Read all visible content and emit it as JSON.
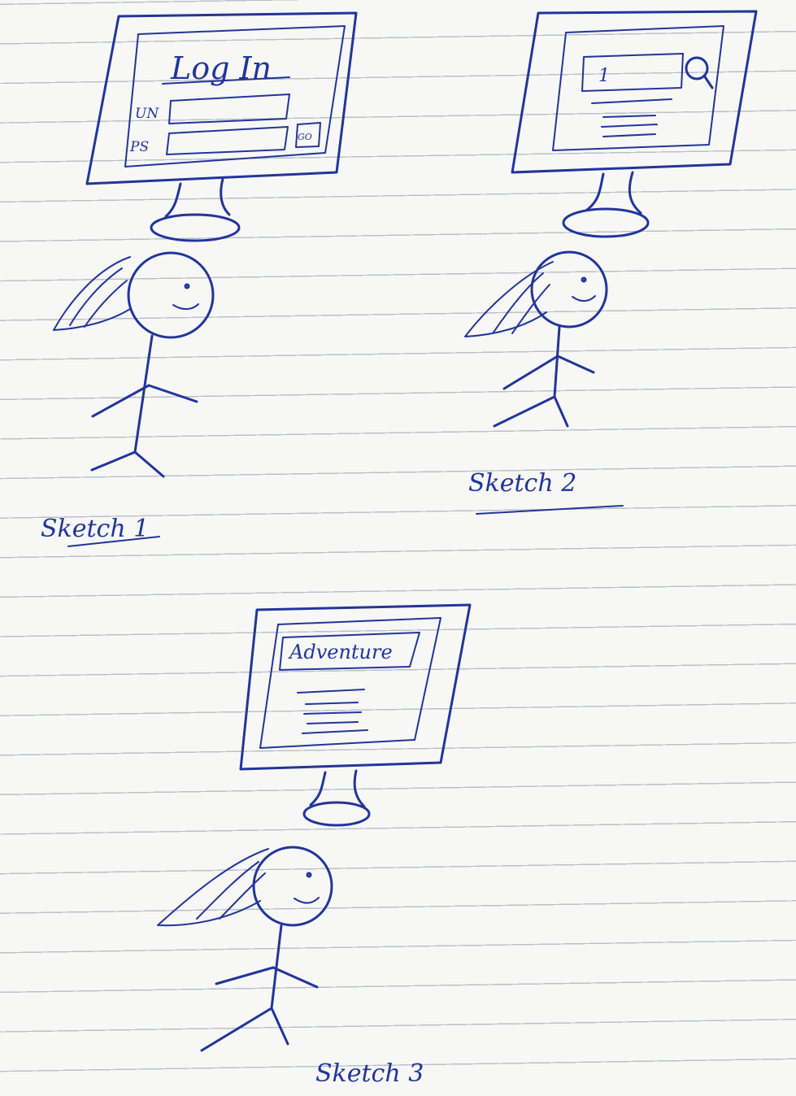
{
  "colors": {
    "ink": "#22359a"
  },
  "sketch1": {
    "screen_title": "Log In",
    "username_label": "UN",
    "password_label": "PS",
    "go_button": "GO",
    "caption": "Sketch 1"
  },
  "sketch2": {
    "search_value": "1",
    "search_icon": "magnifier-icon",
    "caption": "Sketch 2"
  },
  "sketch3": {
    "header_text": "Adventure",
    "caption": "Sketch 3"
  }
}
